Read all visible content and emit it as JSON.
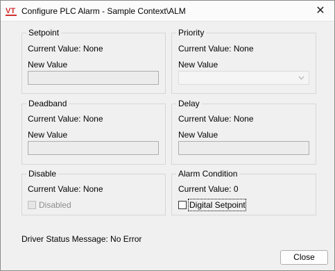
{
  "window": {
    "title": "Configure PLC Alarm - Sample Context\\ALM",
    "logo_text": "VT",
    "close_glyph": "✕"
  },
  "setpoint": {
    "title": "Setpoint",
    "current": "Current Value: None",
    "new_label": "New Value",
    "new_value": ""
  },
  "priority": {
    "title": "Priority",
    "current": "Current Value: None",
    "new_label": "New Value",
    "selected": ""
  },
  "deadband": {
    "title": "Deadband",
    "current": "Current Value: None",
    "new_label": "New Value",
    "new_value": ""
  },
  "delay": {
    "title": "Delay",
    "current": "Current Value: None",
    "new_label": "New Value",
    "new_value": ""
  },
  "disable": {
    "title": "Disable",
    "current": "Current Value: None",
    "checkbox_label": "Disabled",
    "checked": false
  },
  "alarm_condition": {
    "title": "Alarm Condition",
    "current": "Current Value: 0",
    "checkbox_label": "Digital Setpoint",
    "checked": false
  },
  "status": {
    "message": "Driver Status Message: No Error"
  },
  "buttons": {
    "close": "Close"
  },
  "colors": {
    "logo_red": "#d32f2f",
    "window_bg": "#f0f0f0"
  }
}
